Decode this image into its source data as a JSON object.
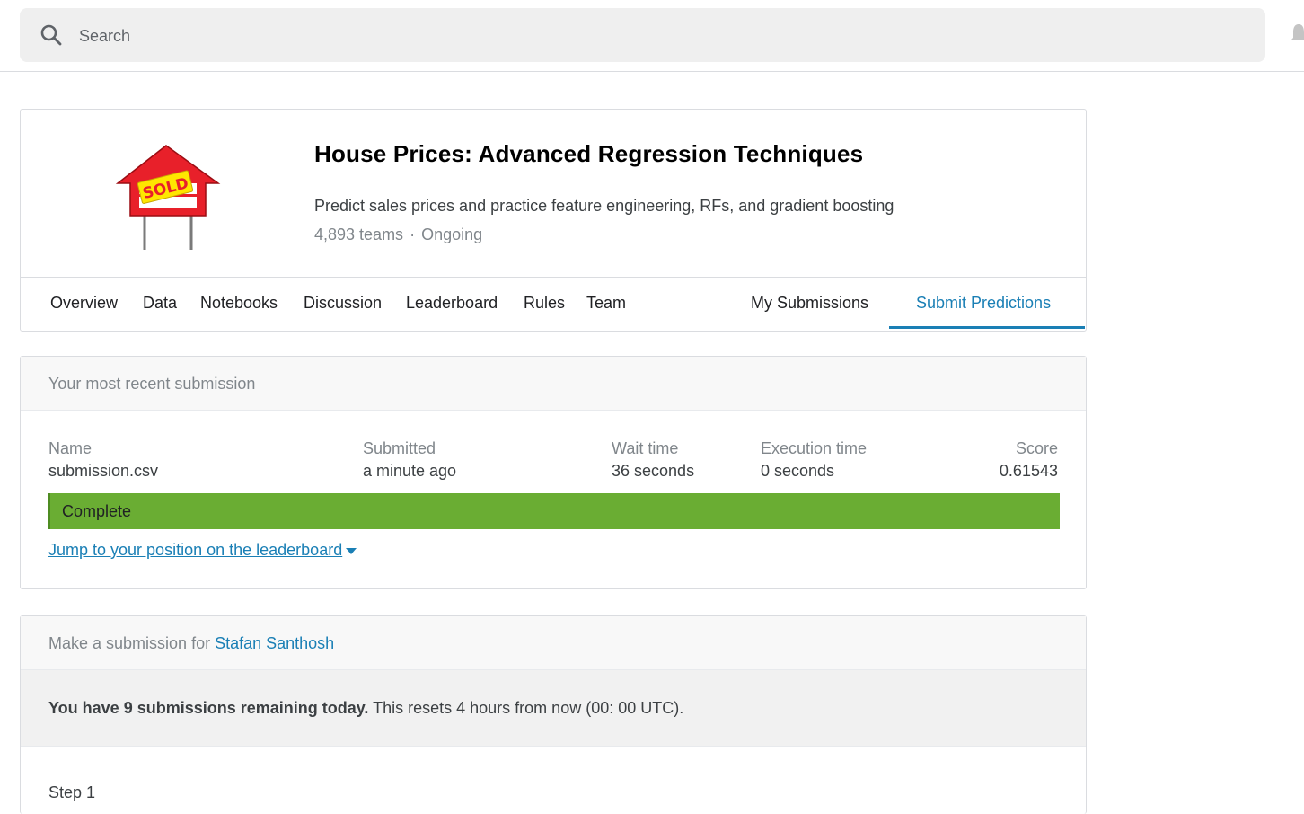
{
  "search": {
    "placeholder": "Search"
  },
  "competition": {
    "title": "House Prices: Advanced Regression Techniques",
    "description": "Predict sales prices and practice feature engineering, RFs, and gradient boosting",
    "teams": "4,893 teams",
    "separator": "·",
    "status": "Ongoing",
    "logo_text": "SOLD"
  },
  "tabs": {
    "left": [
      "Overview",
      "Data",
      "Notebooks",
      "Discussion",
      "Leaderboard",
      "Rules",
      "Team"
    ],
    "my_submissions": "My Submissions",
    "submit_predictions": "Submit Predictions"
  },
  "recent": {
    "heading": "Your most recent submission",
    "name_label": "Name",
    "name_value": "submission.csv",
    "submitted_label": "Submitted",
    "submitted_value": "a minute ago",
    "wait_label": "Wait time",
    "wait_value": "36 seconds",
    "exec_label": "Execution time",
    "exec_value": "0 seconds",
    "score_label": "Score",
    "score_value": "0.61543",
    "status": "Complete",
    "jump_link": "Jump to your position on the leaderboard"
  },
  "submission": {
    "heading_prefix": "Make a submission for ",
    "user": "Stafan Santhosh",
    "remaining_bold": "You have 9 submissions remaining today.",
    "remaining_rest": " This resets 4 hours from now (00: 00 UTC).",
    "step": "Step 1"
  },
  "colors": {
    "accent": "#1a7fb5",
    "complete": "#6aad33",
    "logo_red": "#e8202a",
    "logo_yellow": "#ffe600"
  }
}
